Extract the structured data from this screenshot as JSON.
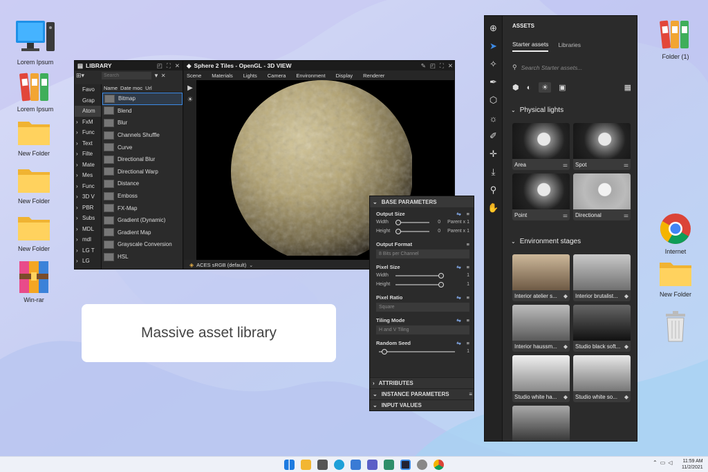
{
  "desktop": {
    "left_icons": [
      {
        "label": "Lorem Ipsum",
        "icon": "computer-icon"
      },
      {
        "label": "Lorem Ipsum",
        "icon": "binders-icon"
      },
      {
        "label": "New Folder",
        "icon": "folder-icon"
      },
      {
        "label": "New Folder",
        "icon": "folder-icon"
      },
      {
        "label": "New Folder",
        "icon": "folder-icon"
      },
      {
        "label": "Win-rar",
        "icon": "winrar-icon"
      }
    ],
    "right_icons": [
      {
        "label": "Folder (1)",
        "icon": "binders-icon"
      },
      {
        "label": "Internet",
        "icon": "chrome-icon"
      },
      {
        "label": "New Folder",
        "icon": "folder-icon"
      },
      {
        "label": "",
        "icon": "recycle-bin-icon"
      }
    ]
  },
  "caption": "Massive asset library",
  "library": {
    "title": "LIBRARY",
    "search_placeholder": "Search",
    "columns": {
      "name": "Name",
      "date": "Date moc",
      "url": "Url"
    },
    "tree": [
      "Favo",
      "Grap",
      "Atom",
      "FxM",
      "Func",
      "Text",
      "Filte",
      "Mate",
      "Mes",
      "Func",
      "3D V",
      "PBR",
      "Subs",
      "MDL",
      "mdl",
      "LG T",
      "LG"
    ],
    "items": [
      "Bitmap",
      "Blend",
      "Blur",
      "Channels Shuffle",
      "Curve",
      "Directional Blur",
      "Directional Warp",
      "Distance",
      "Emboss",
      "FX-Map",
      "Gradient (Dynamic)",
      "Gradient Map",
      "Grayscale Conversion",
      "HSL"
    ]
  },
  "view3d": {
    "title": "Sphere 2 Tiles - OpenGL - 3D VIEW",
    "menu": [
      "Scene",
      "Materials",
      "Lights",
      "Camera",
      "Environment",
      "Display",
      "Renderer"
    ],
    "colorspace": "ACES sRGB (default)"
  },
  "params": {
    "header": "BASE PARAMETERS",
    "output_size": {
      "title": "Output Size",
      "width_label": "Width",
      "height_label": "Height",
      "width_value": "0",
      "height_value": "0",
      "width_parent": "Parent x 1",
      "height_parent": "Parent x 1"
    },
    "output_format": {
      "title": "Output Format",
      "value": "8 Bits per Channel"
    },
    "pixel_size": {
      "title": "Pixel Size",
      "width_label": "Width",
      "height_label": "Height",
      "width_value": "1",
      "height_value": "1"
    },
    "pixel_ratio": {
      "title": "Pixel Ratio",
      "value": "Square"
    },
    "tiling_mode": {
      "title": "Tiling Mode",
      "value": "H and V Tiling"
    },
    "random_seed": {
      "title": "Random Seed",
      "value": "1"
    },
    "sections": [
      "ATTRIBUTES",
      "INSTANCE PARAMETERS",
      "INPUT VALUES"
    ]
  },
  "assets": {
    "title": "ASSETS",
    "tabs": [
      "Starter assets",
      "Libraries"
    ],
    "search_placeholder": "Search Starter assets...",
    "physical_lights": {
      "title": "Physical lights",
      "items": [
        "Area",
        "Spot",
        "Point",
        "Directional"
      ]
    },
    "environment_stages": {
      "title": "Environment stages",
      "items": [
        "Interior atelier s...",
        "Interior brutalist...",
        "Interior haussm...",
        "Studio black soft...",
        "Studio white ha...",
        "Studio white so..."
      ]
    }
  },
  "taskbar": {
    "time": "11:59 AM",
    "date": "11/2/2021"
  },
  "colors": {
    "accent": "#3d8be6",
    "panel": "#2b2b2b",
    "wallpaper": "#cfd6f5"
  }
}
